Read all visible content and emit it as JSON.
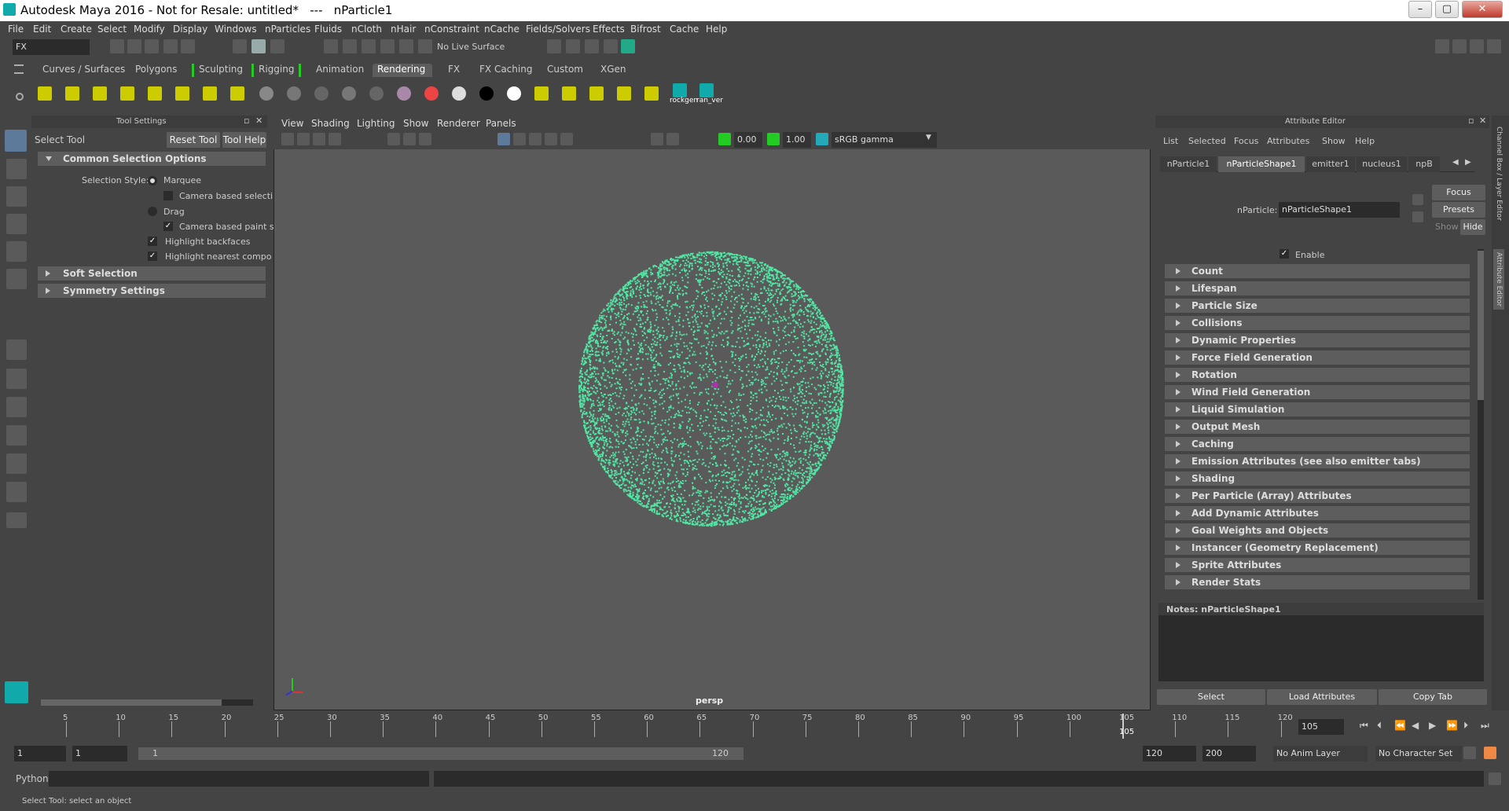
{
  "window": {
    "title": "Autodesk Maya 2016 - Not for Resale: untitled*   ---   nParticle1",
    "min": "–",
    "max": "▢",
    "close": "✕"
  },
  "menus": [
    "File",
    "Edit",
    "Create",
    "Select",
    "Modify",
    "Display",
    "Windows",
    "nParticles",
    "Fluids",
    "nCloth",
    "nHair",
    "nConstraint",
    "nCache",
    "Fields/Solvers",
    "Effects",
    "Bifrost",
    "Cache",
    "Help"
  ],
  "status": {
    "menuset": "FX",
    "live_surface": "No Live Surface"
  },
  "shelf_tabs": [
    "Curves / Surfaces",
    "Polygons",
    "Sculpting",
    "Rigging",
    "Animation",
    "Rendering",
    "FX",
    "FX Caching",
    "Custom",
    "XGen"
  ],
  "shelf_active": "Rendering",
  "shelf_icon_labels": [
    "rockgen",
    "ran_ver"
  ],
  "tool_settings": {
    "panel_title": "Tool Settings",
    "tool_name": "Select Tool",
    "reset": "Reset Tool",
    "help": "Tool Help",
    "common": "Common Selection Options",
    "selection_style": "Selection Style:",
    "marquee": "Marquee",
    "camera_based_sel": "Camera based selecti",
    "drag": "Drag",
    "camera_based_paint": "Camera based paint s",
    "highlight_backfaces": "Highlight backfaces",
    "highlight_nearest": "Highlight nearest compo",
    "soft": "Soft Selection",
    "symmetry": "Symmetry Settings"
  },
  "viewport": {
    "menus": [
      "View",
      "Shading",
      "Lighting",
      "Show",
      "Renderer",
      "Panels"
    ],
    "near": "0.00",
    "far": "1.00",
    "color_space": "sRGB gamma",
    "camera": "persp"
  },
  "attribute_editor": {
    "panel_title": "Attribute Editor",
    "menus": [
      "List",
      "Selected",
      "Focus",
      "Attributes",
      "Show",
      "Help"
    ],
    "tabs": [
      "nParticle1",
      "nParticleShape1",
      "emitter1",
      "nucleus1",
      "npB"
    ],
    "active_tab": "nParticleShape1",
    "node_label": "nParticle:",
    "node_value": "nParticleShape1",
    "focus": "Focus",
    "presets": "Presets",
    "show": "Show",
    "hide": "Hide",
    "enable": "Enable",
    "sections": [
      "Count",
      "Lifespan",
      "Particle Size",
      "Collisions",
      "Dynamic Properties",
      "Force Field Generation",
      "Rotation",
      "Wind Field Generation",
      "Liquid Simulation",
      "Output Mesh",
      "Caching",
      "Emission Attributes (see also emitter tabs)",
      "Shading",
      "Per Particle (Array) Attributes",
      "Add Dynamic Attributes",
      "Goal Weights and Objects",
      "Instancer (Geometry Replacement)",
      "Sprite Attributes",
      "Render Stats"
    ],
    "notes": "Notes:  nParticleShape1",
    "select": "Select",
    "load": "Load Attributes",
    "copy": "Copy Tab",
    "side_tabs": "Channel Box / Layer Editor",
    "side_tab2": "Attribute Editor"
  },
  "timeline": {
    "ticks": [
      "5",
      "10",
      "15",
      "20",
      "25",
      "30",
      "35",
      "40",
      "45",
      "50",
      "55",
      "60",
      "65",
      "70",
      "75",
      "80",
      "85",
      "90",
      "95",
      "100",
      "105",
      "110",
      "115",
      "120"
    ],
    "current": "105",
    "current_field": "105"
  },
  "range": {
    "start": "1",
    "start2": "1",
    "slider_start": "1",
    "slider_end": "120",
    "end": "120",
    "end2": "200",
    "anim_layer": "No Anim Layer",
    "char_set": "No Character Set"
  },
  "cmd": {
    "lang": "Python"
  },
  "help_line": "Select Tool: select an object",
  "colors": {
    "particles": "#52e6a4",
    "accent": "#5d5d5d"
  }
}
